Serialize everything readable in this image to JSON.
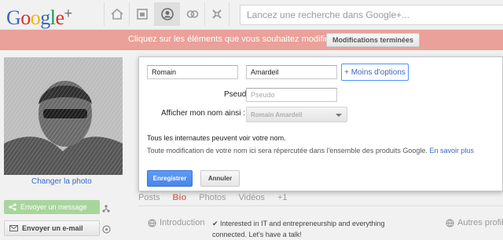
{
  "brand": {
    "logo_letters": [
      "G",
      "o",
      "o",
      "g",
      "l",
      "e"
    ],
    "logo_colors": [
      "#3b66c4",
      "#d93025",
      "#f4b400",
      "#3b66c4",
      "#0f9d58",
      "#d93025"
    ],
    "logo_plus": "+"
  },
  "topbar": {
    "nav_icons": [
      "home-icon",
      "photos-icon",
      "profile-icon",
      "circles-icon",
      "games-icon"
    ],
    "search_placeholder": "Lancez une recherche dans Google+..."
  },
  "banner": {
    "text": "Cliquez sur les éléments que vous souhaitez modifier.",
    "done_button": "Modifications terminées",
    "color": "#e9a199"
  },
  "sidebar": {
    "change_photo": "Changer la photo",
    "message_button": "Envoyer un message",
    "email_button": "Envoyer un e-mail"
  },
  "dialog": {
    "first_name": "Romain",
    "last_name": "Amardeil",
    "less_options": "+ Moins d'options",
    "nickname_label": "Pseudo :",
    "nickname_placeholder": "Pseudo",
    "display_label": "Afficher mon nom ainsi :",
    "display_value": "Romain Amardeil",
    "public_note": "Tous les internautes peuvent voir votre nom.",
    "notice": "Toute modification de votre nom ici sera répercutée dans l'ensemble des produits Google.",
    "learn_more": "En savoir plus",
    "save_button": "Enregistrer",
    "cancel_button": "Annuler",
    "accent": "#4d90fe"
  },
  "tabs": [
    {
      "label": "Posts",
      "active": false
    },
    {
      "label": "Bio",
      "active": true
    },
    {
      "label": "Photos",
      "active": false
    },
    {
      "label": "Vidéos",
      "active": false
    },
    {
      "label": "+1",
      "active": false
    }
  ],
  "bio": {
    "intro_label": "Introduction",
    "intro_text": "✔ Interested in IT and entrepreneurship and everything connected. Let's have a talk!",
    "other_profiles": "Autres profils"
  }
}
